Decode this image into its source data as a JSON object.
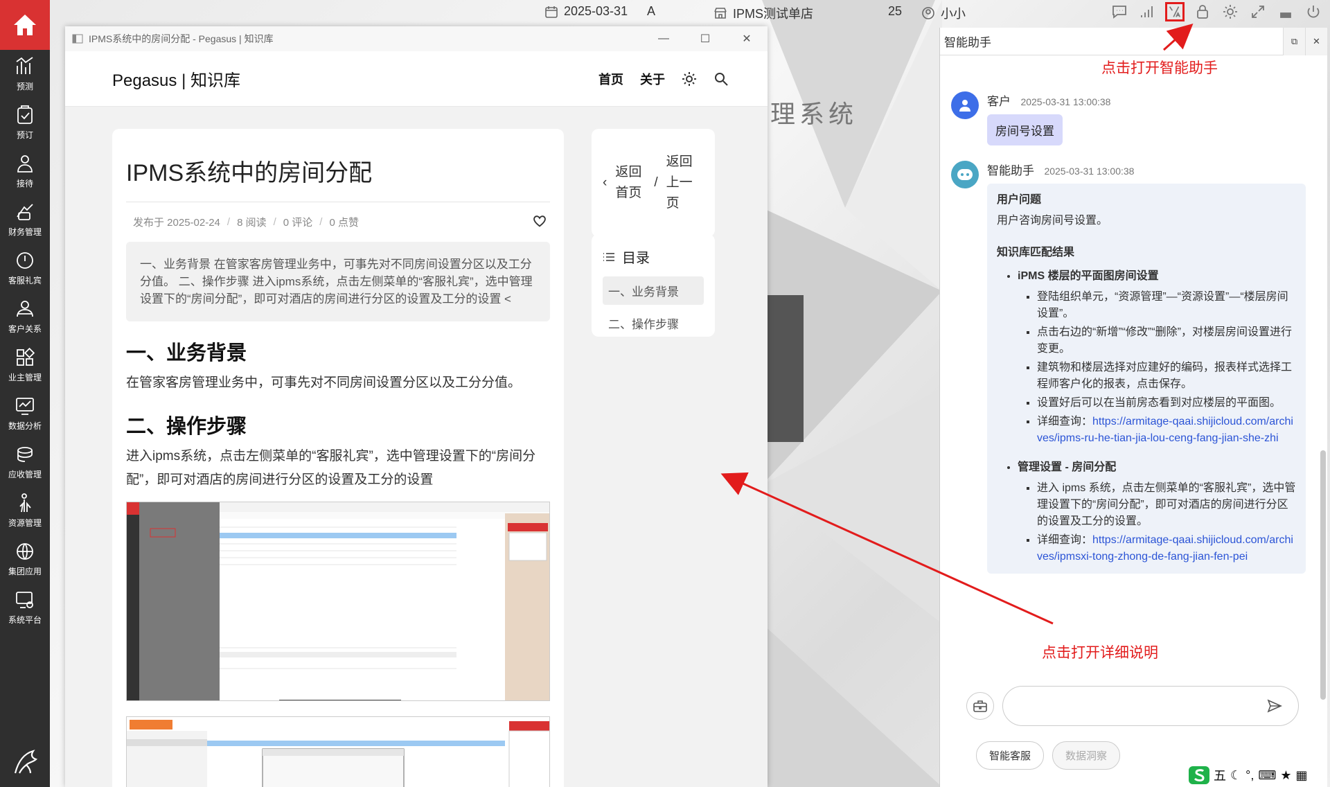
{
  "topbar": {
    "date": "2025-03-31",
    "shift": "A",
    "hotel": "IPMS测试单店",
    "number": "25",
    "user": "小小"
  },
  "sidebar": {
    "items": [
      {
        "label": "预测",
        "icon": "forecast-chart-icon"
      },
      {
        "label": "预订",
        "icon": "booking-clipboard-icon"
      },
      {
        "label": "接待",
        "icon": "reception-person-icon"
      },
      {
        "label": "财务管理",
        "icon": "finance-icon"
      },
      {
        "label": "客服礼宾",
        "icon": "concierge-clock-icon"
      },
      {
        "label": "客户关系",
        "icon": "customers-icon"
      },
      {
        "label": "业主管理",
        "icon": "owner-grid-icon"
      },
      {
        "label": "数据分析",
        "icon": "analytics-icon"
      },
      {
        "label": "应收管理",
        "icon": "receivable-icon"
      },
      {
        "label": "资源管理",
        "icon": "resource-icon"
      },
      {
        "label": "集团应用",
        "icon": "globe-icon"
      },
      {
        "label": "系统平台",
        "icon": "system-settings-icon"
      }
    ]
  },
  "kb_window": {
    "title": "IPMS系统中的房间分配 - Pegasus | 知识库",
    "brand": "Pegasus | 知识库",
    "nav": [
      "首页",
      "关于"
    ],
    "article": {
      "title": "IPMS系统中的房间分配",
      "published": "发布于 2025-02-24",
      "reads": "8 阅读",
      "comments": "0 评论",
      "likes": "0 点赞",
      "summary": "一、业务背景 在管家客房管理业务中，可事先对不同房间设置分区以及工分分值。 二、操作步骤 进入ipms系统，点击左侧菜单的“客服礼宾”，选中管理设置下的“房间分配”，即可对酒店的房间进行分区的设置及工分的设置 <",
      "h1": "一、业务背景",
      "p1": "在管家客房管理业务中，可事先对不同房间设置分区以及工分分值。",
      "h2": "二、操作步骤",
      "p2": "进入ipms系统，点击左侧菜单的“客服礼宾”，选中管理设置下的“房间分配”，即可对酒店的房间进行分区的设置及工分的设置"
    },
    "back": {
      "home": "返回首页",
      "sep": "/",
      "prev": "返回上一页"
    },
    "toc": {
      "title": "目录",
      "items": [
        "一、业务背景",
        "二、操作步骤"
      ]
    }
  },
  "background_title": "理系统",
  "assistant": {
    "title": "智能助手",
    "user_msg": {
      "name": "客户",
      "time": "2025-03-31 13:00:38",
      "text": "房间号设置"
    },
    "ai_msg": {
      "name": "智能助手",
      "time": "2025-03-31 13:00:38",
      "q_head": "用户问题",
      "q_text": "用户咨询房间号设置。",
      "kb_head": "知识库匹配结果",
      "r1_title": "iPMS 楼层的平面图房间设置",
      "r1_items": [
        "登陆组织单元，“资源管理”—“资源设置”—“楼层房间设置”。",
        "点击右边的“新增”“修改”“删除”，对楼层房间设置进行变更。",
        "建筑物和楼层选择对应建好的编码，报表样式选择工程师客户化的报表，点击保存。",
        "设置好后可以在当前房态看到对应楼层的平面图。"
      ],
      "r1_detail_label": "详细查询：",
      "r1_link": "https://armitage-qaai.shijicloud.com/archives/ipms-ru-he-tian-jia-lou-ceng-fang-jian-she-zhi",
      "r2_title": "管理设置 - 房间分配",
      "r2_item": "进入 ipms 系统，点击左侧菜单的“客服礼宾”，选中管理设置下的“房间分配”，即可对酒店的房间进行分区的设置及工分的设置。",
      "r2_detail_label": "详细查询：",
      "r2_link": "https://armitage-qaai.shijicloud.com/archives/ipmsxi-tong-zhong-de-fang-jian-fen-pei"
    },
    "chips": [
      "智能客服",
      "数据洞察"
    ]
  },
  "annotations": {
    "top": "点击打开智能助手",
    "bottom": "点击打开详细说明",
    "color": "#e21c1c"
  },
  "ime": {
    "mode": "五"
  }
}
